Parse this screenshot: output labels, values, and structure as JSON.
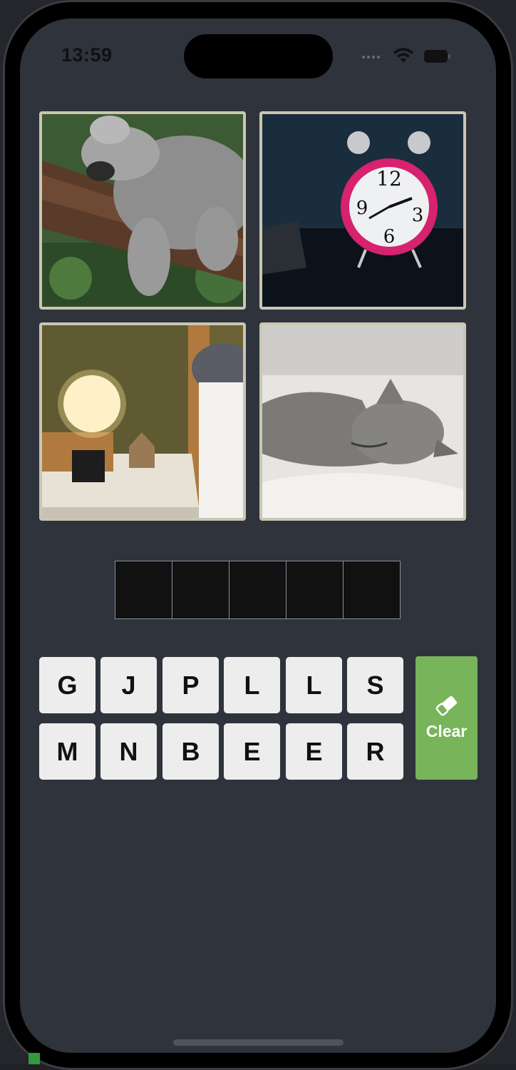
{
  "status_bar": {
    "time": "13:59"
  },
  "images": [
    {
      "name": "koala-sleeping",
      "icon": "koala-photo"
    },
    {
      "name": "alarm-clock",
      "icon": "clock-photo"
    },
    {
      "name": "bedside-lamp",
      "icon": "lamp-photo"
    },
    {
      "name": "cat-sleeping",
      "icon": "cat-photo"
    }
  ],
  "answer": {
    "slots": [
      "",
      "",
      "",
      "",
      ""
    ]
  },
  "keyboard": {
    "row1": [
      "G",
      "J",
      "P",
      "L",
      "L",
      "S"
    ],
    "row2": [
      "M",
      "N",
      "B",
      "E",
      "E",
      "R"
    ]
  },
  "clear_button": {
    "label": "Clear",
    "color": "#78b45a"
  },
  "colors": {
    "screen_bg": "#2f333c",
    "tile_border": "#c9c6b3",
    "key_bg": "#ededed",
    "slot_bg": "#111111"
  }
}
